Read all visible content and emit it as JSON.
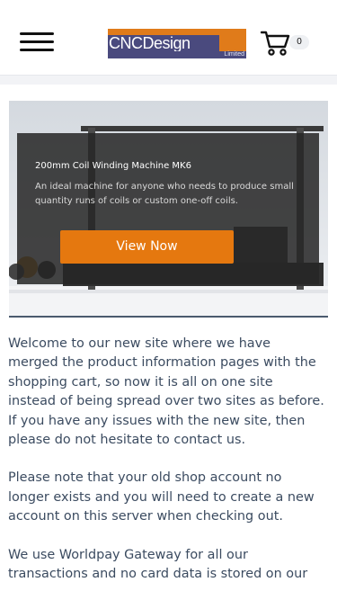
{
  "header": {
    "logo": {
      "name": "CNCDesign",
      "suffix": "Limited",
      "colors": {
        "purple": "#4a4a7e",
        "orange": "#e07b1a"
      }
    },
    "menu_icon": "hamburger-menu-icon",
    "cart_icon": "shopping-cart-icon",
    "cart_count": "0"
  },
  "hero": {
    "title": "200mm Coil Winding Machine MK6",
    "description": "An ideal machine for anyone who needs to produce small quantity runs of coils or custom one-off coils.",
    "button_label": "View Now",
    "button_color": "#e5780f"
  },
  "content": {
    "para1": "Welcome to our new site where we have merged the product information pages with the shopping cart, so now it is all on one site instead of being spread over two sites as before.",
    "para2": "If you have any issues with the new site, then please do not hesitate to contact us.",
    "para3": "Please note that your old shop account no longer exists and you will need to create a new account on this server when checking out.",
    "para4": "We use Worldpay Gateway for all our transactions and no card data is stored on our"
  }
}
